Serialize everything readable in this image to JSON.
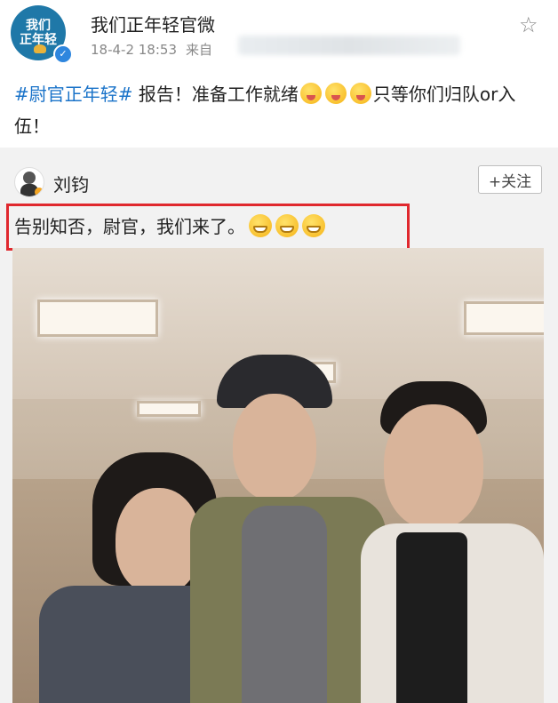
{
  "post": {
    "account_name": "我们正年轻官微",
    "avatar_text_line1": "我们",
    "avatar_text_line2": "正年轻",
    "timestamp": "18-4-2 18:53",
    "source_prefix": "来自",
    "topic": "#尉官正年轻#",
    "text_part1": " 报告！准备工作就绪",
    "text_part2": "只等你们归队or入伍！"
  },
  "repost": {
    "user_name": "刘钧",
    "follow_label": "+关注",
    "text": "告别知否，尉官，我们来了。"
  },
  "icons": {
    "star": "star-icon",
    "verified": "verified-badge-icon",
    "tongue_emoji": "tongue-out-emoji-icon",
    "grin_emoji": "grin-emoji-icon"
  },
  "colors": {
    "topic_link": "#1a73c9",
    "highlight_border": "#e0282e",
    "repost_background": "#f2f2f2"
  }
}
